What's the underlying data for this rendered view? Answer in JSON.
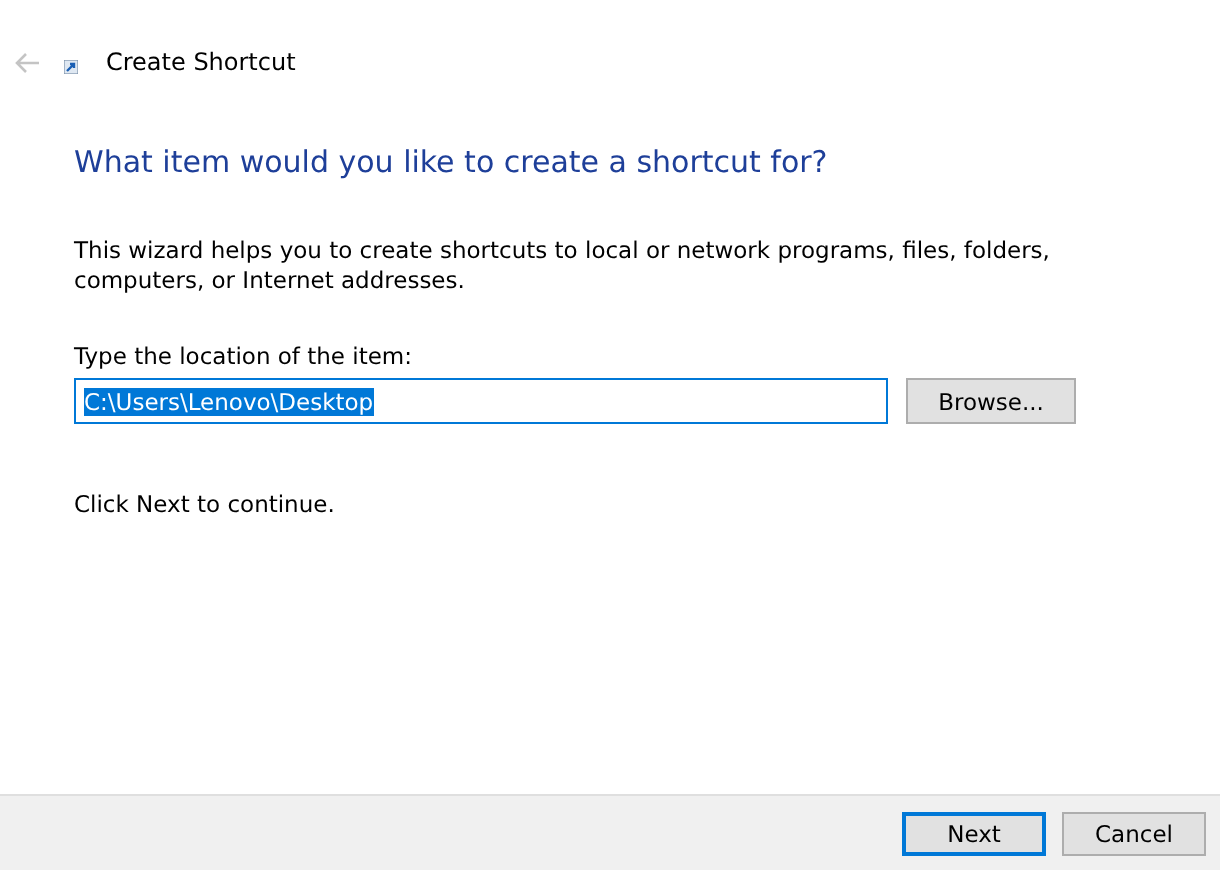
{
  "window": {
    "title": "Create Shortcut",
    "back_enabled": false
  },
  "heading": "What item would you like to create a shortcut for?",
  "description": "This wizard helps you to create shortcuts to local or network programs, files, folders, computers, or Internet addresses.",
  "location": {
    "label": "Type the location of the item:",
    "value": "C:\\Users\\Lenovo\\Desktop",
    "text_selected": true,
    "browse": "Browse..."
  },
  "hint": "Click Next to continue.",
  "buttons": [
    {
      "label": "Next",
      "default": true
    },
    {
      "label": "Cancel",
      "default": false
    }
  ]
}
